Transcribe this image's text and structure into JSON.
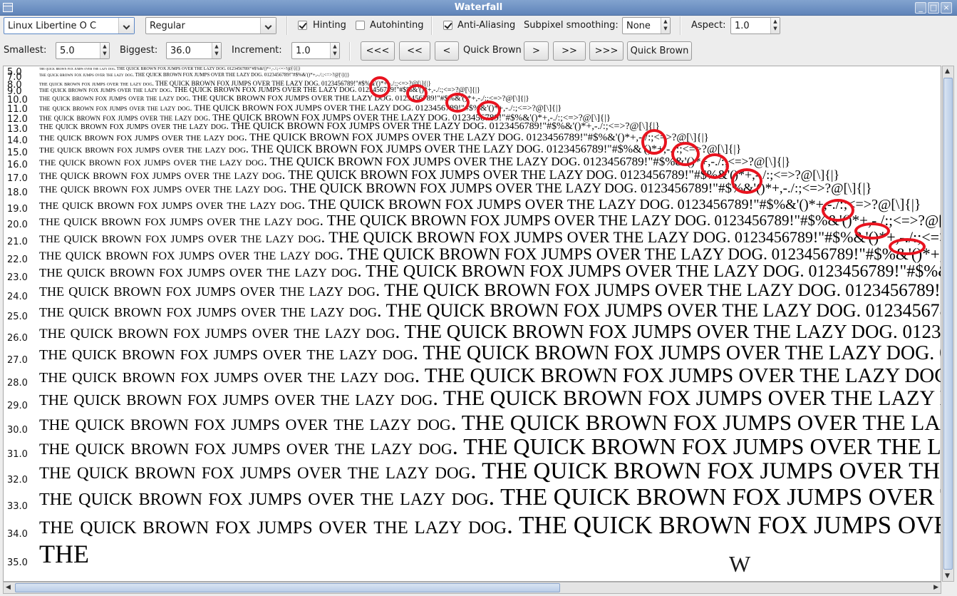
{
  "window": {
    "title": "Waterfall",
    "buttons": [
      "_",
      "□",
      "×"
    ]
  },
  "toolbar": {
    "font_family": "Linux Libertine O C",
    "font_style": "Regular",
    "hinting": {
      "label": "Hinting",
      "checked": true
    },
    "autohinting": {
      "label": "Autohinting",
      "checked": false
    },
    "antialiasing": {
      "label": "Anti-Aliasing",
      "checked": true
    },
    "subpixel_label": "Subpixel smoothing:",
    "subpixel_value": "None",
    "aspect_label": "Aspect:",
    "aspect_value": "1.0",
    "smallest_label": "Smallest:",
    "smallest_value": "5.0",
    "biggest_label": "Biggest:",
    "biggest_value": "36.0",
    "increment_label": "Increment:",
    "increment_value": "1.0",
    "nav": {
      "first": "<<<",
      "prev_page": "<<",
      "prev": "<",
      "current_text": "Quick Brown",
      "next": ">",
      "next_page": ">>",
      "last": ">>>",
      "text_button": "Quick Brown"
    }
  },
  "waterfall": {
    "sample_smallcaps": "the quick brown fox jumps over the lazy dog.",
    "sample_caps": "THE QUICK BROWN FOX JUMPS OVER THE LAZY DOG.",
    "sample_symbols": "0123456789!\"#$%&'()*+,-./:;<=>?@[\\]{|}",
    "last_row_text": "THE",
    "stray_glyph": "W",
    "sizes": [
      "5.0",
      "7.0",
      "8.0",
      "9.0",
      "10.0",
      "11.0",
      "12.0",
      "13.0",
      "14.0",
      "15.0",
      "16.0",
      "17.0",
      "18.0",
      "19.0",
      "20.0",
      "21.0",
      "22.0",
      "23.0",
      "24.0",
      "25.0",
      "26.0",
      "27.0",
      "28.0",
      "29.0",
      "30.0",
      "31.0",
      "32.0",
      "33.0",
      "34.0",
      "35.0"
    ],
    "marked_sizes": [
      "8.0",
      "9.0",
      "10.0",
      "11.0",
      "14.0",
      "15.0",
      "16.0",
      "17.0",
      "19.0",
      "20.0",
      "21.0"
    ],
    "annotation_color": "#e8131f"
  }
}
